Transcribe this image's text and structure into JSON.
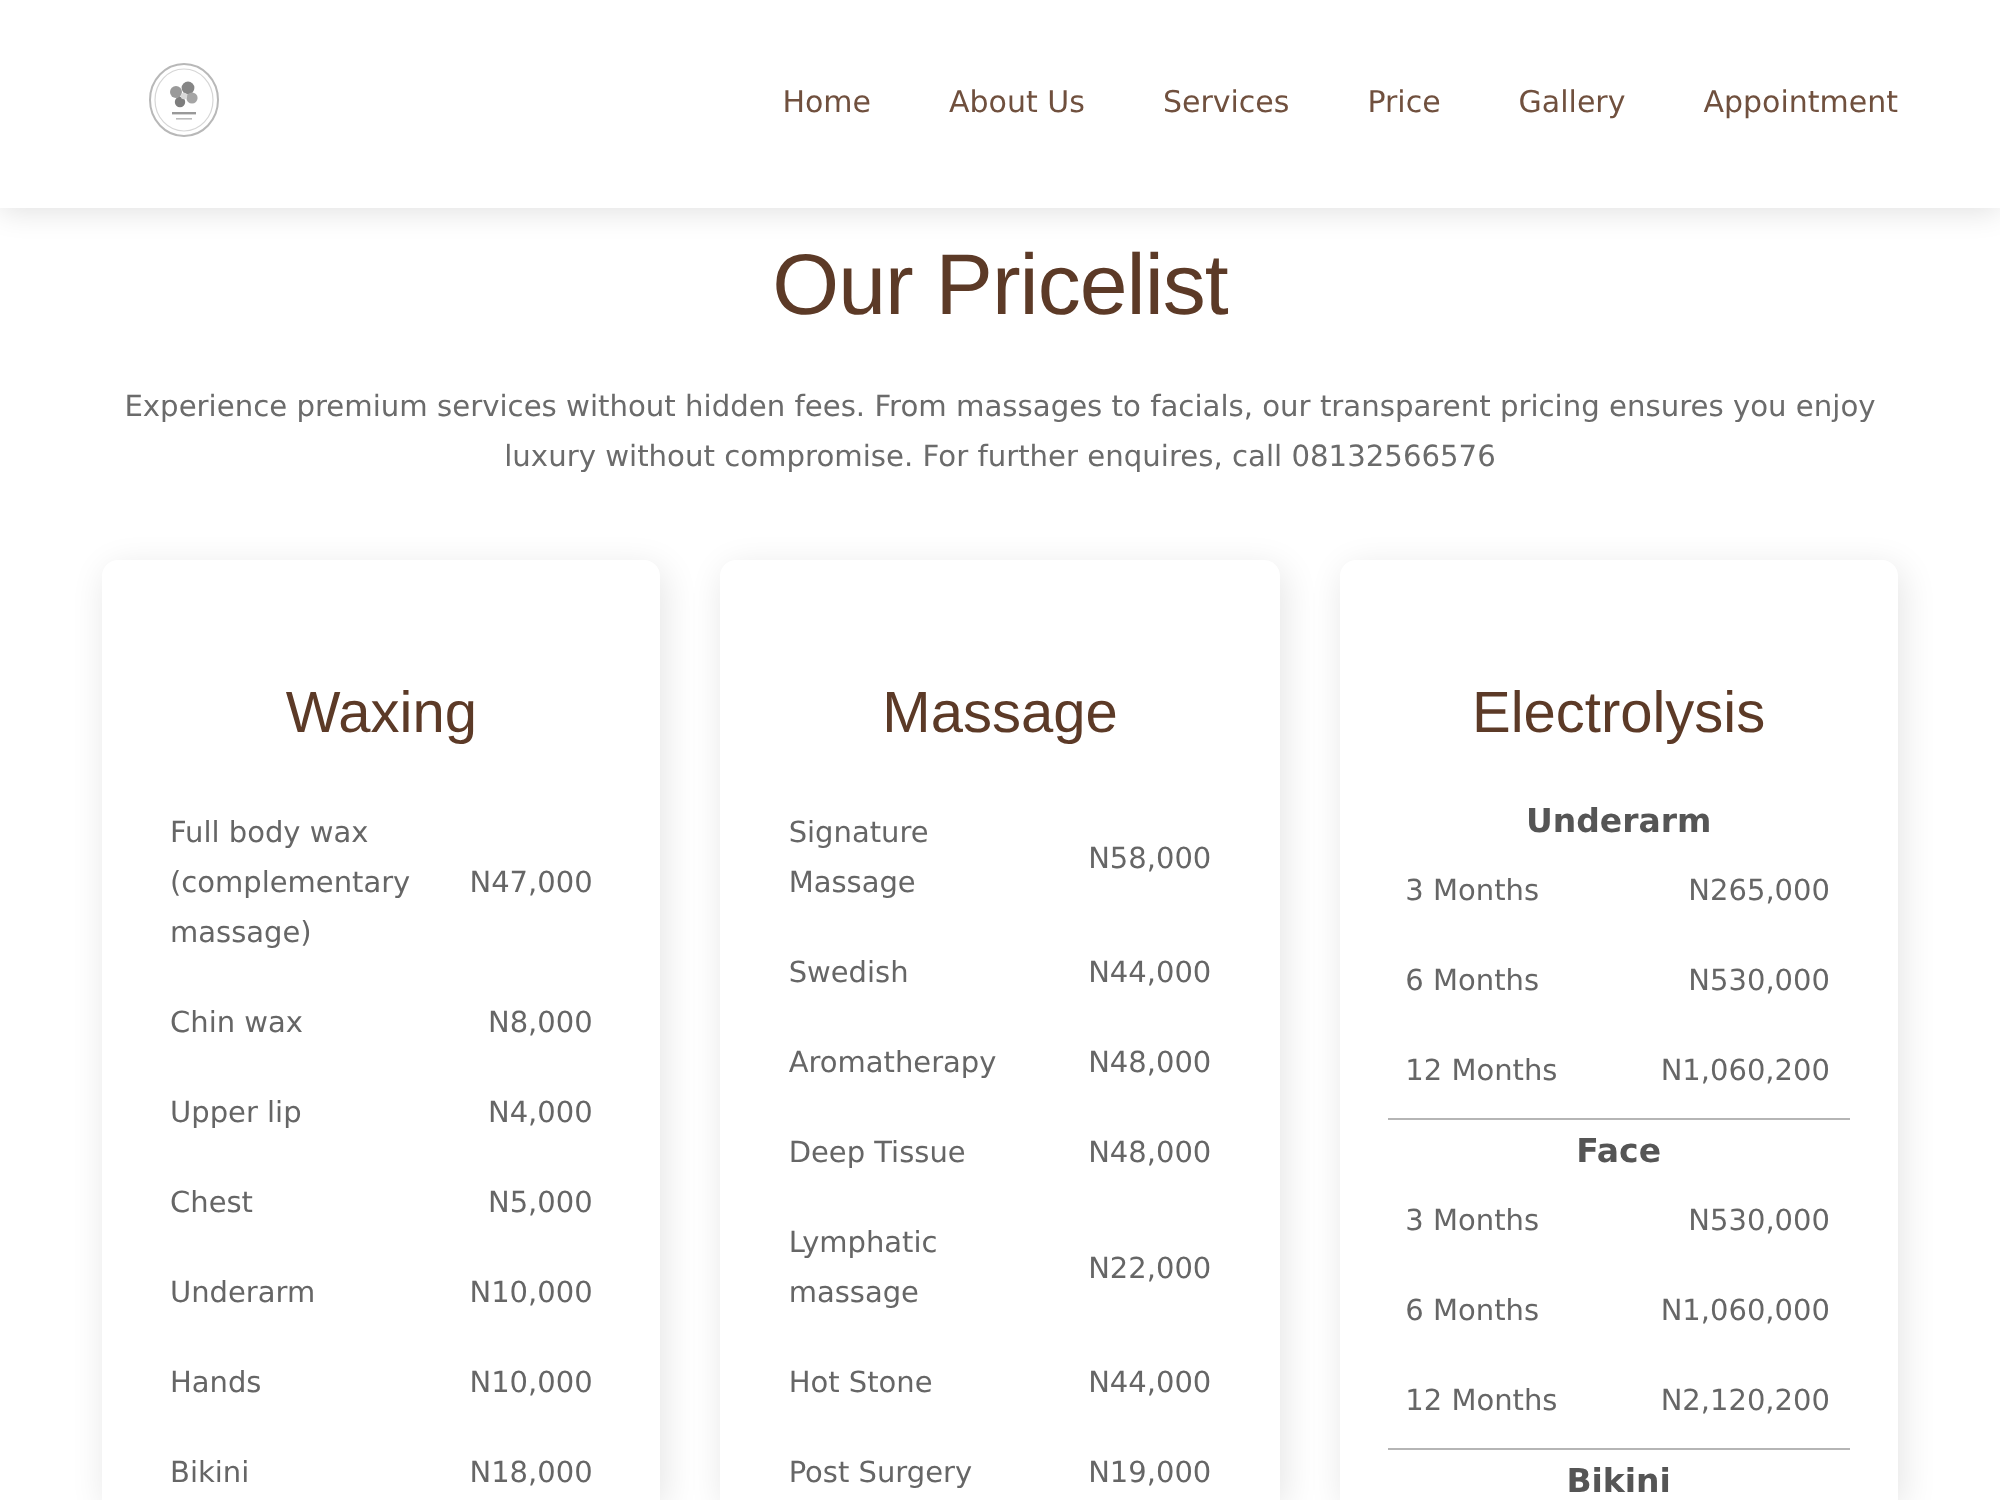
{
  "header": {
    "nav": [
      "Home",
      "About Us",
      "Services",
      "Price",
      "Gallery",
      "Appointment"
    ]
  },
  "pricelist": {
    "title": "Our Pricelist",
    "intro": "Experience premium services without hidden fees. From massages to facials, our transparent pricing ensures you enjoy luxury without compromise. For further enquires, call 08132566576"
  },
  "price_cards": [
    {
      "title": "Waxing",
      "kind": "simple",
      "items": [
        {
          "name": "Full body wax (complementary massage)",
          "price": "N47,000"
        },
        {
          "name": "Chin wax",
          "price": "N8,000"
        },
        {
          "name": "Upper lip",
          "price": "N4,000"
        },
        {
          "name": "Chest",
          "price": "N5,000"
        },
        {
          "name": "Underarm",
          "price": "N10,000"
        },
        {
          "name": "Hands",
          "price": "N10,000"
        },
        {
          "name": "Bikini",
          "price": "N18,000"
        }
      ]
    },
    {
      "title": "Massage",
      "kind": "simple",
      "items": [
        {
          "name": "Signature Massage",
          "price": "N58,000"
        },
        {
          "name": "Swedish",
          "price": "N44,000"
        },
        {
          "name": "Aromatherapy",
          "price": "N48,000"
        },
        {
          "name": "Deep Tissue",
          "price": "N48,000"
        },
        {
          "name": "Lymphatic massage",
          "price": "N22,000"
        },
        {
          "name": "Hot Stone",
          "price": "N44,000"
        },
        {
          "name": "Post Surgery",
          "price": "N19,000"
        }
      ]
    },
    {
      "title": "Electrolysis",
      "kind": "grouped",
      "groups": [
        {
          "heading": "Underarm",
          "items": [
            {
              "name": "3 Months",
              "price": "N265,000"
            },
            {
              "name": "6 Months",
              "price": "N530,000"
            },
            {
              "name": "12 Months",
              "price": "N1,060,200"
            }
          ]
        },
        {
          "heading": "Face",
          "items": [
            {
              "name": "3 Months",
              "price": "N530,000"
            },
            {
              "name": "6 Months",
              "price": "N1,060,000"
            },
            {
              "name": "12 Months",
              "price": "N2,120,200"
            }
          ]
        },
        {
          "heading": "Bikini"
        }
      ]
    }
  ]
}
